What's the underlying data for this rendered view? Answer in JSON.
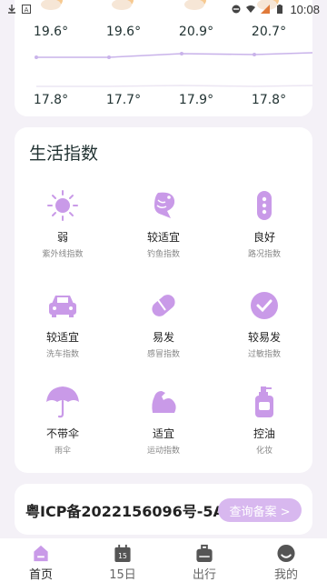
{
  "status": {
    "time": "10:08"
  },
  "forecast": {
    "highs": [
      "19.6°",
      "19.6°",
      "20.9°",
      "20.7°"
    ],
    "lows": [
      "17.8°",
      "17.7°",
      "17.9°",
      "17.8°"
    ]
  },
  "life_index": {
    "title": "生活指数",
    "items": [
      {
        "value": "弱",
        "label": "紫外线指数",
        "icon": "sun-icon"
      },
      {
        "value": "较适宜",
        "label": "钓鱼指数",
        "icon": "fish-icon"
      },
      {
        "value": "良好",
        "label": "路况指数",
        "icon": "traffic-light-icon"
      },
      {
        "value": "较适宜",
        "label": "洗车指数",
        "icon": "car-icon"
      },
      {
        "value": "易发",
        "label": "感冒指数",
        "icon": "pill-icon"
      },
      {
        "value": "较易发",
        "label": "过敏指数",
        "icon": "check-circle-icon"
      },
      {
        "value": "不带伞",
        "label": "雨伞",
        "icon": "umbrella-icon"
      },
      {
        "value": "适宜",
        "label": "运动指数",
        "icon": "muscle-icon"
      },
      {
        "value": "控油",
        "label": "化妆",
        "icon": "cosmetic-bottle-icon"
      }
    ]
  },
  "icp": {
    "text": "粤ICP备2022156096号-5A",
    "button_label": "查询备案 >"
  },
  "nav": {
    "items": [
      {
        "label": "首页",
        "icon": "home-icon"
      },
      {
        "label": "15日",
        "icon": "calendar-icon",
        "badge": "15"
      },
      {
        "label": "出行",
        "icon": "travel-bag-icon"
      },
      {
        "label": "我的",
        "icon": "profile-icon"
      }
    ]
  },
  "colors": {
    "accent": "#d8b8ef",
    "icon_purple": "#c99ae8"
  }
}
